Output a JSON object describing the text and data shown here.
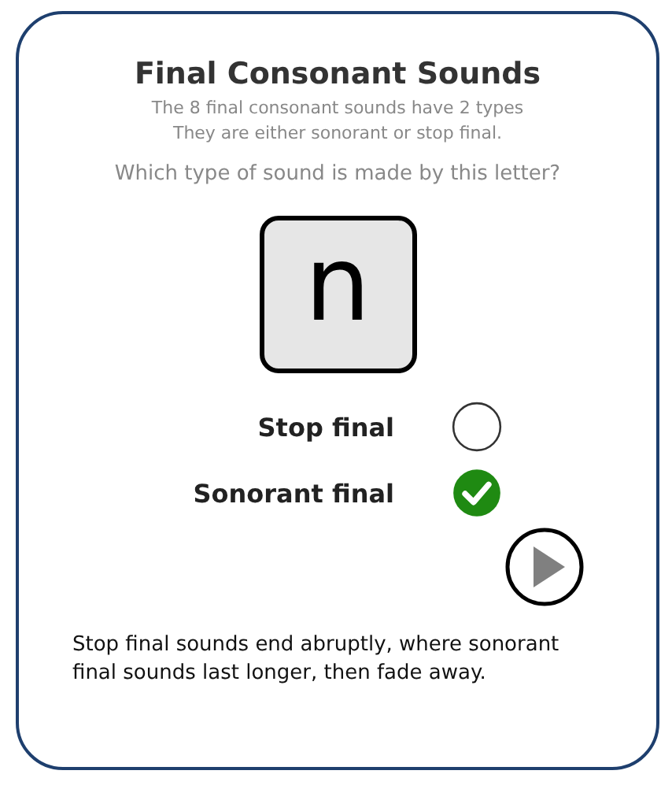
{
  "title": "Final Consonant Sounds",
  "subtitle_lines": [
    "The 8 final consonant sounds have 2 types",
    "They are either sonorant or stop final."
  ],
  "question": "Which type of sound is made by this letter?",
  "letter": "n",
  "options": [
    {
      "label": "Stop final",
      "selected": false
    },
    {
      "label": "Sonorant final",
      "selected": true
    }
  ],
  "explanation": "Stop final sounds end abruptly, where sonorant final sounds last longer, then fade away."
}
